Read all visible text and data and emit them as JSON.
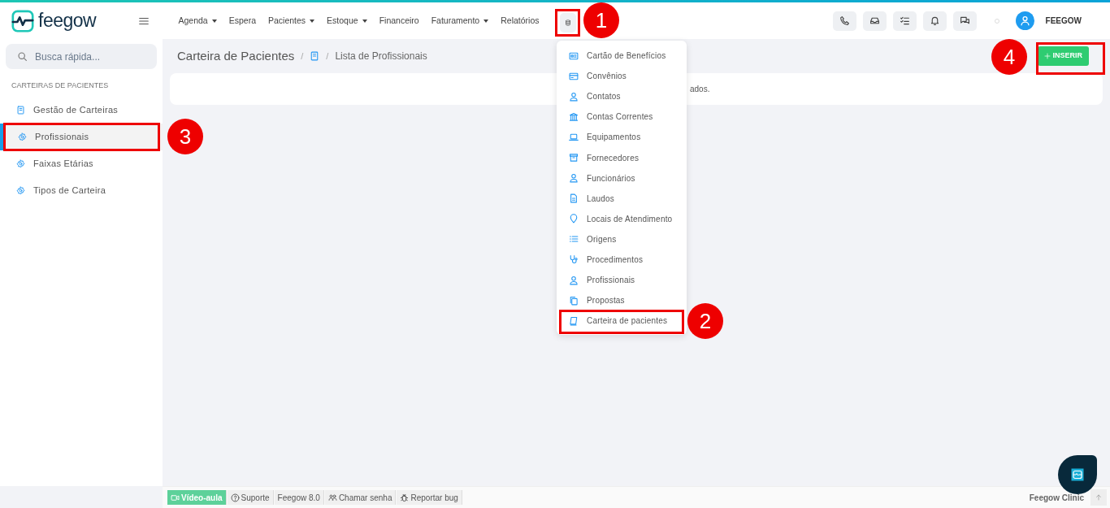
{
  "logo": {
    "text": "feegow"
  },
  "nav": [
    {
      "label": "Agenda",
      "dropdown": true
    },
    {
      "label": "Espera",
      "dropdown": false
    },
    {
      "label": "Pacientes",
      "dropdown": true
    },
    {
      "label": "Estoque",
      "dropdown": true
    },
    {
      "label": "Financeiro",
      "dropdown": false
    },
    {
      "label": "Faturamento",
      "dropdown": true
    },
    {
      "label": "Relatórios",
      "dropdown": false
    }
  ],
  "user": {
    "name": "FEEGOW"
  },
  "search": {
    "placeholder": "Busca rápida..."
  },
  "sidebar": {
    "heading": "CARTEIRAS DE PACIENTES",
    "items": [
      {
        "label": "Gestão de Carteiras",
        "selected": false
      },
      {
        "label": "Profissionais",
        "selected": true
      },
      {
        "label": "Faixas Etárias",
        "selected": false
      },
      {
        "label": "Tipos de Carteira",
        "selected": false
      }
    ]
  },
  "breadcrumb": {
    "title": "Carteira de Pacientes",
    "separator": "/",
    "current": "Lista de Profissionais"
  },
  "insert_button": {
    "label": "INSERIR"
  },
  "message": "ados.",
  "menu": [
    {
      "label": "Cartão de Benefícios"
    },
    {
      "label": "Convênios"
    },
    {
      "label": "Contatos"
    },
    {
      "label": "Contas Correntes"
    },
    {
      "label": "Equipamentos"
    },
    {
      "label": "Fornecedores"
    },
    {
      "label": "Funcionários"
    },
    {
      "label": "Laudos"
    },
    {
      "label": "Locais de Atendimento"
    },
    {
      "label": "Origens"
    },
    {
      "label": "Procedimentos"
    },
    {
      "label": "Profissionais"
    },
    {
      "label": "Propostas"
    },
    {
      "label": "Carteira de pacientes"
    }
  ],
  "footer": {
    "buttons": [
      {
        "label": "Vídeo-aula",
        "kind": "primary"
      },
      {
        "label": "Suporte",
        "kind": "plain"
      },
      {
        "label": "Feegow 8.0",
        "kind": "plain"
      },
      {
        "label": "Chamar senha",
        "kind": "plain"
      },
      {
        "label": "Reportar bug",
        "kind": "plain"
      }
    ],
    "brand": "Feegow Clinic"
  },
  "annotations": [
    {
      "number": "1"
    },
    {
      "number": "2"
    },
    {
      "number": "3"
    },
    {
      "number": "4"
    }
  ]
}
